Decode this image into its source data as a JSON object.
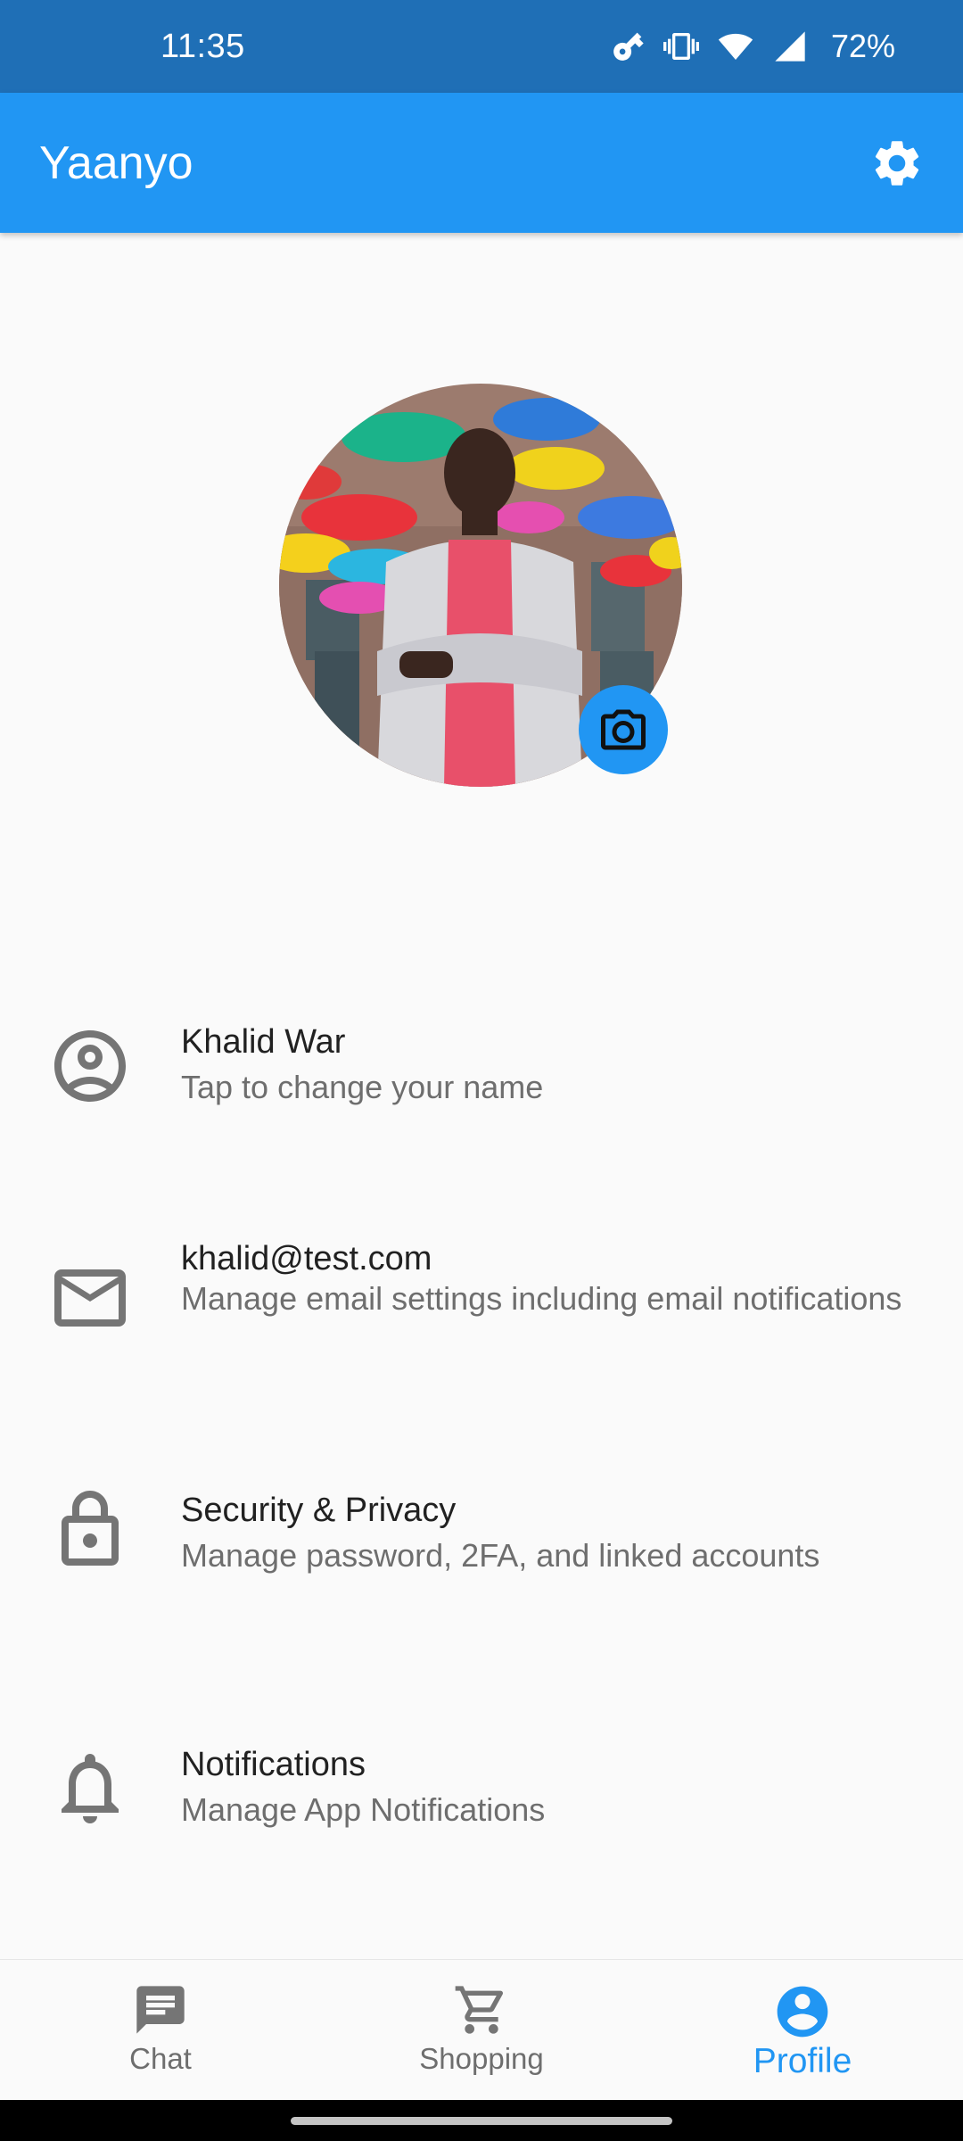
{
  "status_bar": {
    "time": "11:35",
    "battery": "72%",
    "icons": [
      "key-icon",
      "vibrate-icon",
      "wifi-icon",
      "cell-signal-icon"
    ]
  },
  "app_bar": {
    "title": "Yaanyo",
    "settings_icon": "gear-icon"
  },
  "profile": {
    "camera_icon": "camera-icon"
  },
  "list": [
    {
      "icon": "account-circle-icon",
      "title": "Khalid War",
      "subtitle": "Tap to change your name"
    },
    {
      "icon": "mail-icon",
      "title": "khalid@test.com",
      "subtitle": "Manage email settings including email notifications"
    },
    {
      "icon": "lock-icon",
      "title": "Security & Privacy",
      "subtitle": "Manage password, 2FA, and linked accounts"
    },
    {
      "icon": "bell-icon",
      "title": "Notifications",
      "subtitle": "Manage App Notifications"
    }
  ],
  "bottom_nav": [
    {
      "icon": "chat-icon",
      "label": "Chat",
      "active": false
    },
    {
      "icon": "cart-icon",
      "label": "Shopping",
      "active": false
    },
    {
      "icon": "account-circle-icon",
      "label": "Profile",
      "active": true
    }
  ],
  "colors": {
    "status_bar": "#1f6fb6",
    "primary": "#2196f3",
    "icon_gray": "#757575",
    "background": "#fafafa"
  }
}
